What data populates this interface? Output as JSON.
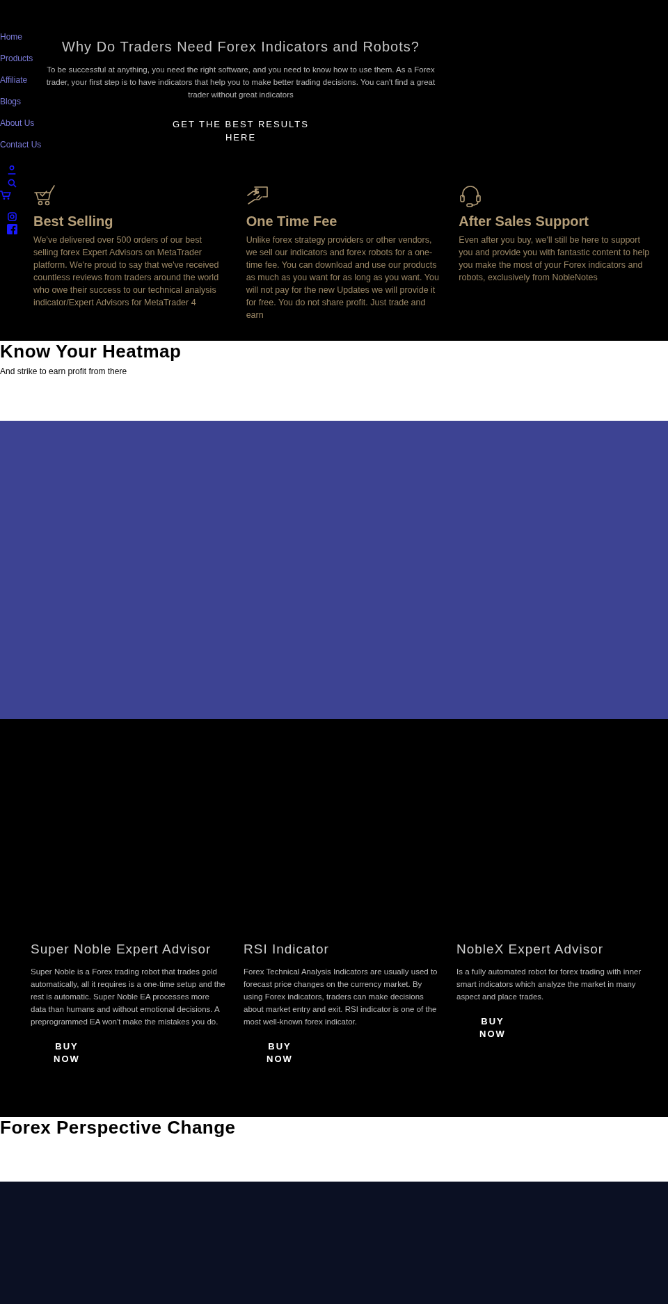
{
  "nav": {
    "links": [
      {
        "label": "Home"
      },
      {
        "label": "Products"
      },
      {
        "label": "Affiliate"
      },
      {
        "label": "Blogs"
      },
      {
        "label": "About Us"
      },
      {
        "label": "Contact Us"
      }
    ]
  },
  "hero": {
    "title": "Why Do Traders Need Forex Indicators and Robots?",
    "text": "To be successful at anything, you need the right software, and you need to know how to use them. As a Forex trader, your first step is to have indicators that help you to make better trading decisions. You can't find a great trader without great indicators",
    "button": "GET THE BEST RESULTS HERE"
  },
  "features": [
    {
      "kind": "cart",
      "title": "Best Selling",
      "text": "We've delivered over 500 orders of our best selling forex Expert Advisors on MetaTrader platform. We're proud to say that we've received countless reviews from traders around the world who owe their success to our technical analysis indicator/Expert Advisors for MetaTrader 4"
    },
    {
      "kind": "payment",
      "title": "One Time Fee",
      "text": "Unlike forex strategy providers or other vendors, we sell our indicators and forex robots for a one-time fee. You can download and use our products as much as you want for as long as you want. You will not pay for the new Updates we will provide it for free. You do not share profit. Just trade and earn"
    },
    {
      "kind": "headset",
      "title": "After Sales Support",
      "text": "Even after you buy, we'll still be here to support you and provide you with fantastic content to help you make the most of your Forex indicators and robots, exclusively from NobleNotes"
    }
  ],
  "heatmap": {
    "title": "Know Your Heatmap",
    "subtitle": "And strike to earn profit from there"
  },
  "products": [
    {
      "title": "Super Noble Expert Advisor",
      "text": "Super Noble is a Forex trading robot that trades gold automatically, all it requires is a one-time setup and the rest is automatic. Super Noble EA processes more data than humans and without emotional decisions. A preprogrammed EA won't make the mistakes you do.",
      "button": "BUY NOW"
    },
    {
      "title": "RSI Indicator",
      "text": "Forex Technical Analysis Indicators are usually used to forecast price changes on the currency market. By using Forex indicators, traders can make decisions about market entry and exit. RSI indicator is one of the most well-known forex indicator.",
      "button": "BUY NOW"
    },
    {
      "title": "NobleX Expert Advisor",
      "text": "Is a fully automated robot for forex trading with inner smart indicators which analyze the market in many aspect and place trades.",
      "button": "BUY NOW"
    }
  ],
  "perspective": {
    "title": "Forex Perspective Change"
  }
}
